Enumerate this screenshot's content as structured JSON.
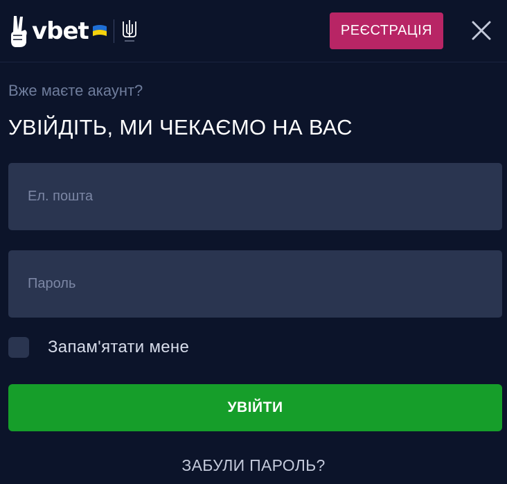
{
  "header": {
    "logo_text": "vbet",
    "register_label": "РЕЄСТРАЦІЯ",
    "close_icon": "close-icon"
  },
  "login": {
    "subtitle": "Вже маєте акаунт?",
    "title": "УВІЙДІТЬ, МИ ЧЕКАЄМО НА ВАС",
    "email_placeholder": "Ел. пошта",
    "password_placeholder": "Пароль",
    "remember_label": "Запам'ятати мене",
    "remember_checked": false,
    "submit_label": "УВІЙТИ",
    "forgot_label": "ЗАБУЛИ ПАРОЛЬ?"
  },
  "colors": {
    "background": "#0c142a",
    "register": "#b82565",
    "submit": "#169e2a",
    "field": "#2a3550"
  }
}
